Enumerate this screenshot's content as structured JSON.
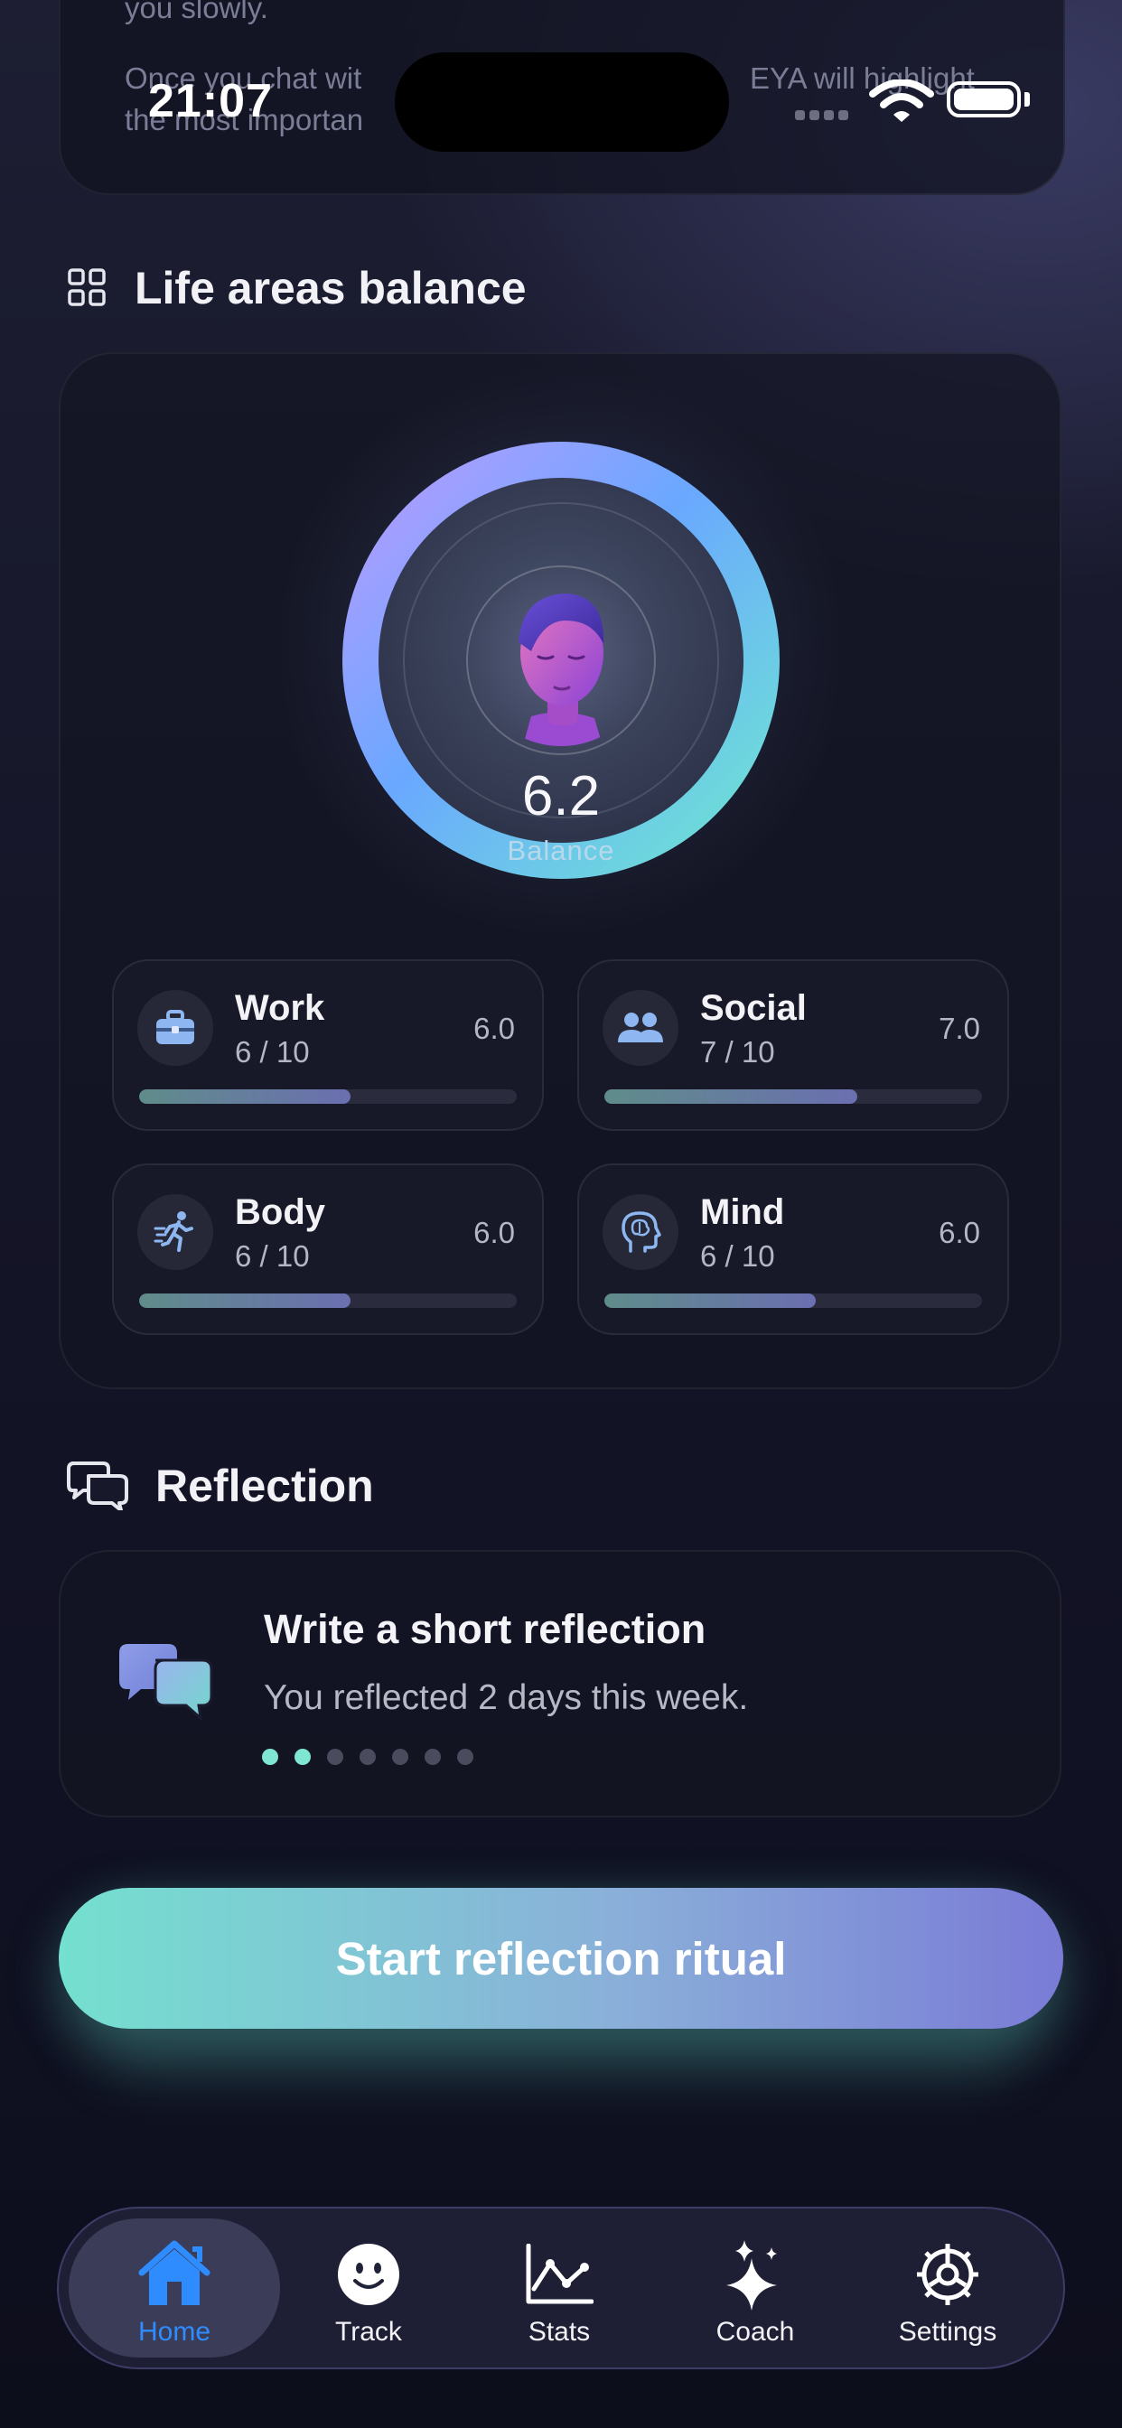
{
  "status_bar": {
    "time": "21:07"
  },
  "top_card": {
    "line1": "you slowly.",
    "line2a": "Once you chat wit",
    "line2b": "EYA will highlight",
    "line3": "the most importan"
  },
  "life_areas": {
    "title": "Life areas balance",
    "icon": "grid-icon",
    "score": "6.2",
    "score_label": "Balance",
    "ring_colors": [
      "#b79bff",
      "#6aa8ff",
      "#6ee6d2"
    ],
    "areas": [
      {
        "name": "Work",
        "sub": "6 / 10",
        "value": "6.0",
        "fraction": 0.56,
        "icon": "briefcase-icon"
      },
      {
        "name": "Social",
        "sub": "7 / 10",
        "value": "7.0",
        "fraction": 0.67,
        "icon": "people-icon"
      },
      {
        "name": "Body",
        "sub": "6 / 10",
        "value": "6.0",
        "fraction": 0.56,
        "icon": "running-person-icon"
      },
      {
        "name": "Mind",
        "sub": "6 / 10",
        "value": "6.0",
        "fraction": 0.56,
        "icon": "brain-head-icon"
      }
    ]
  },
  "reflection": {
    "title": "Reflection",
    "icon": "chat-bubbles-icon",
    "card_title": "Write a short reflection",
    "card_sub": "You reflected 2 days this week.",
    "days_filled": 2,
    "days_total": 7,
    "accent": "#7fe6d3"
  },
  "cta": {
    "label": "Start reflection ritual"
  },
  "tabbar": {
    "tabs": [
      {
        "label": "Home",
        "icon": "home-icon",
        "active": true
      },
      {
        "label": "Track",
        "icon": "smiley-icon",
        "active": false
      },
      {
        "label": "Stats",
        "icon": "line-chart-icon",
        "active": false
      },
      {
        "label": "Coach",
        "icon": "sparkles-icon",
        "active": false
      },
      {
        "label": "Settings",
        "icon": "gear-icon",
        "active": false
      }
    ],
    "active_color": "#2f8cff"
  }
}
